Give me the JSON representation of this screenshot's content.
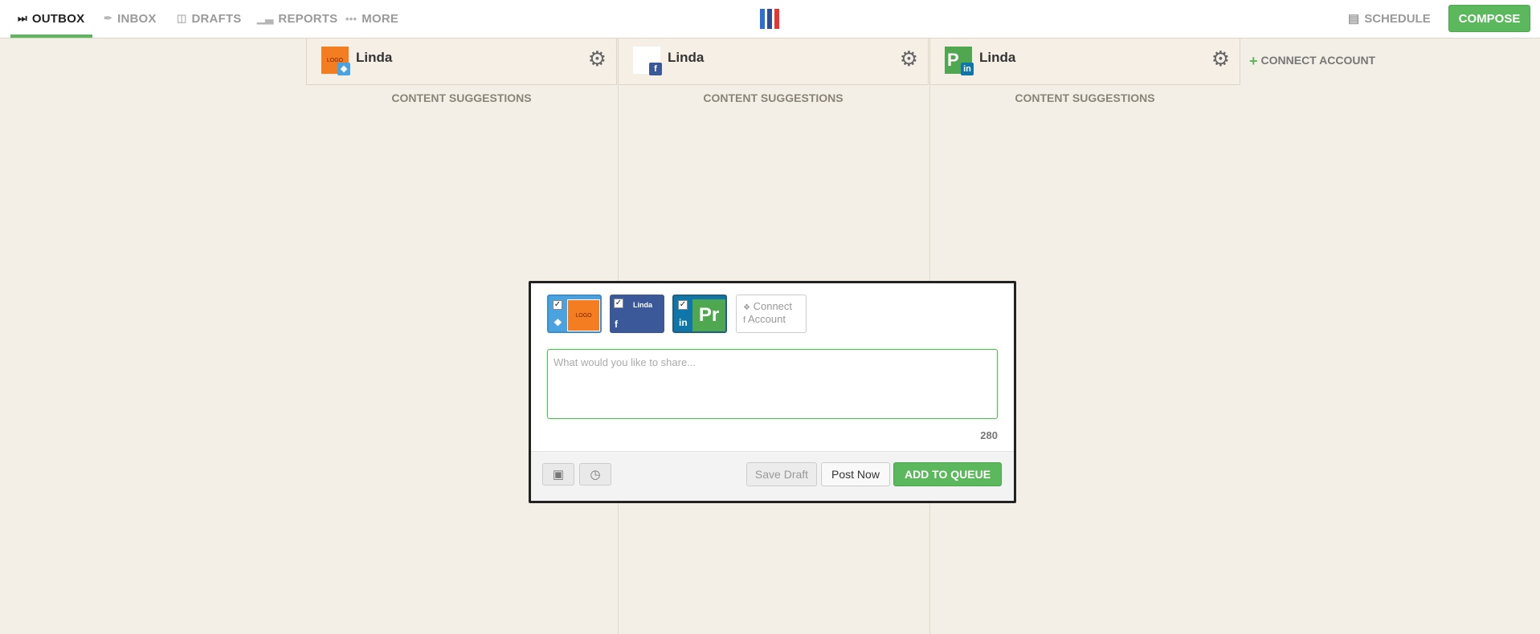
{
  "nav": {
    "items": [
      {
        "label": "OUTBOX",
        "icon": "outbox-icon",
        "active": true
      },
      {
        "label": "INBOX",
        "icon": "feather-icon",
        "active": false
      },
      {
        "label": "DRAFTS",
        "icon": "document-icon",
        "active": false
      },
      {
        "label": "REPORTS",
        "icon": "bar-chart-icon",
        "active": false
      },
      {
        "label": "MORE",
        "icon": "ellipsis-icon",
        "active": false
      }
    ],
    "schedule_label": "SCHEDULE",
    "compose_label": "COMPOSE"
  },
  "brand_colors": [
    "#2d6fd6",
    "#2d4d9a",
    "#e8352f"
  ],
  "accent_color": "#5cb85c",
  "columns": [
    {
      "name": "Linda",
      "network": "twitter",
      "avatar": "LOGO",
      "suggestions_label": "CONTENT SUGGESTIONS"
    },
    {
      "name": "Linda",
      "network": "facebook",
      "avatar": "",
      "suggestions_label": "CONTENT SUGGESTIONS"
    },
    {
      "name": "Linda",
      "network": "linkedin",
      "avatar": "P",
      "suggestions_label": "CONTENT SUGGESTIONS"
    }
  ],
  "connect_account_label": "CONNECT ACCOUNT",
  "composer": {
    "accounts": [
      {
        "network": "twitter",
        "checked": true,
        "thumb_text": "LOGO"
      },
      {
        "network": "facebook",
        "checked": true,
        "thumb_text": "Linda"
      },
      {
        "network": "linkedin",
        "checked": true,
        "thumb_text": "Pr"
      }
    ],
    "connect_label_line1": "Connect",
    "connect_label_line2": "Account",
    "placeholder": "What would you like to share...",
    "char_count": "280",
    "save_draft_label": "Save Draft",
    "post_now_label": "Post Now",
    "add_to_queue_label": "ADD TO QUEUE"
  }
}
